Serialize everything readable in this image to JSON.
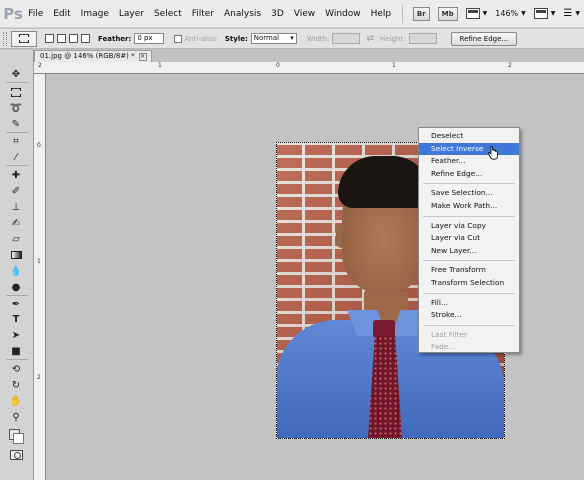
{
  "menubar": {
    "logo": "Ps",
    "items": [
      "File",
      "Edit",
      "Image",
      "Layer",
      "Select",
      "Filter",
      "Analysis",
      "3D",
      "View",
      "Window",
      "Help"
    ],
    "bridge_label": "Br",
    "minibridge_label": "Mb",
    "zoom_value": "146%"
  },
  "options": {
    "feather_label": "Feather:",
    "feather_value": "0 px",
    "antialias_label": "Anti-alias",
    "style_label": "Style:",
    "style_value": "Normal",
    "width_label": "Width:",
    "height_label": "Height:",
    "refine_edge_label": "Refine Edge..."
  },
  "document": {
    "tab_title": "01.jpg @ 146% (RGB/8#) *",
    "close_label": "×"
  },
  "rulers": {
    "top": [
      "2",
      "1",
      "0",
      "1",
      "2"
    ],
    "left": [
      "0",
      "1",
      "2"
    ]
  },
  "context_menu": {
    "items": [
      {
        "label": "Deselect",
        "state": "normal"
      },
      {
        "label": "Select Inverse",
        "state": "highlighted"
      },
      {
        "label": "Feather...",
        "state": "normal"
      },
      {
        "label": "Refine Edge...",
        "state": "normal"
      },
      {
        "label": "Save Selection...",
        "state": "normal"
      },
      {
        "label": "Make Work Path...",
        "state": "normal"
      },
      {
        "label": "Layer via Copy",
        "state": "normal"
      },
      {
        "label": "Layer via Cut",
        "state": "normal"
      },
      {
        "label": "New Layer...",
        "state": "normal"
      },
      {
        "label": "Free Transform",
        "state": "normal"
      },
      {
        "label": "Transform Selection",
        "state": "normal"
      },
      {
        "label": "Fill...",
        "state": "normal"
      },
      {
        "label": "Stroke...",
        "state": "normal"
      },
      {
        "label": "Last Filter",
        "state": "disabled"
      },
      {
        "label": "Fade...",
        "state": "disabled"
      }
    ]
  },
  "colors": {
    "menu_highlight": "#3f78d8",
    "canvas_bg": "#c3c3c3",
    "shirt": "#4f78c8",
    "tie": "#6f1628"
  }
}
